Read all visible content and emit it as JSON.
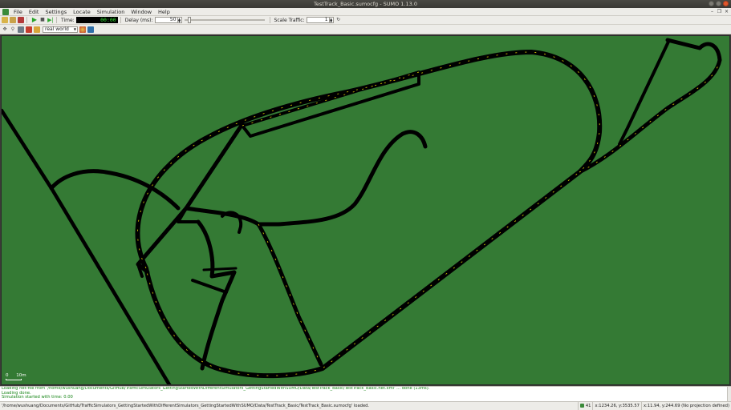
{
  "window": {
    "title": "TestTrack_Basic.sumocfg - SUMO 1.13.0"
  },
  "menu": [
    "File",
    "Edit",
    "Settings",
    "Locate",
    "Simulation",
    "Window",
    "Help"
  ],
  "toolbar": {
    "time_label": "Time:",
    "time_value": "00:00",
    "delay_label": "Delay (ms):",
    "delay_value": "50",
    "delay_slider_fraction": 0.05,
    "scale_traffic_label": "Scale Traffic:",
    "scale_traffic_value": "1"
  },
  "view": {
    "scheme": "real world",
    "scale_label": "10m",
    "scale_zero": "0"
  },
  "messages": [
    "Loading net-file from '/home/wushuang/Documents/GitHub/TrafficSimulators_GettingStartedWithDifferentSimulators_GettingStartedWithSUMO/Data/TestTrack_Basic/TestTrack_Basic.net.xml' ... done (13ms).",
    "Loading done.",
    "Simulation started with time: 0.00"
  ],
  "status": {
    "text": "'/home/wushuang/Documents/GitHub/TrafficSimulators_GettingStartedWithDifferentSimulators_GettingStartedWithSUMO/Data/TestTrack_Basic/TestTrack_Basic.sumocfg' loaded.",
    "vehicle_count": "41",
    "coords": "x:1234.26, y:3535.57",
    "geo": "x:11.94, y:244.69 (No projection defined)"
  },
  "colors": {
    "ground": "#347a34",
    "road": "#000000",
    "lane_marking": "#e6d200"
  }
}
